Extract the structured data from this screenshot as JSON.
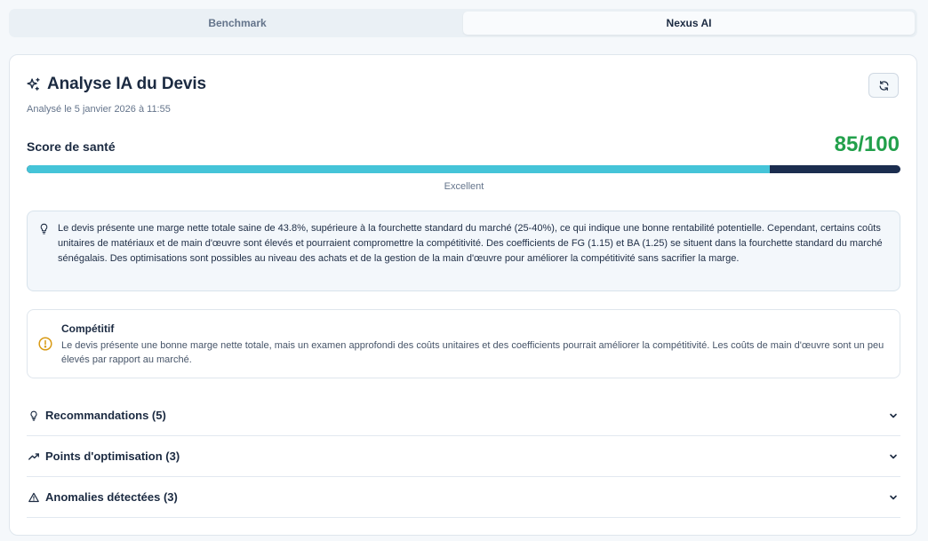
{
  "tabs": [
    {
      "label": "Benchmark",
      "active": false
    },
    {
      "label": "Nexus AI",
      "active": true
    }
  ],
  "analysis": {
    "title": "Analyse IA du Devis",
    "timestamp": "Analysé le 5 janvier 2026 à 11:55",
    "refresh_icon": "refresh-icon",
    "sparkles_icon": "sparkles-icon"
  },
  "score": {
    "label": "Score de santé",
    "display": "85/100",
    "value": 85,
    "max": 100,
    "caption": "Excellent",
    "color": "#22a04b",
    "bar_fill_color": "#45c4d8",
    "bar_track_color": "#1b2d4f"
  },
  "summary": {
    "icon": "lightbulb-icon",
    "text": "Le devis présente une marge nette totale saine de 43.8%, supérieure à la fourchette standard du marché (25-40%), ce qui indique une bonne rentabilité potentielle. Cependant, certains coûts unitaires de matériaux et de main d'œuvre sont élevés et pourraient compromettre la compétitivité. Des coefficients de FG (1.15) et BA (1.25) se situent dans la fourchette standard du marché sénégalais. Des optimisations sont possibles au niveau des achats et de la gestion de la main d'œuvre pour améliorer la compétitivité sans sacrifier la marge."
  },
  "status": {
    "icon": "warning-circle-icon",
    "title": "Compétitif",
    "text": "Le devis présente une bonne marge nette totale, mais un examen approfondi des coûts unitaires et des coefficients pourrait améliorer la compétitivité. Les coûts de main d'œuvre sont un peu élevés par rapport au marché.",
    "accent": "#d99a14"
  },
  "sections": [
    {
      "icon": "lightbulb-icon",
      "label": "Recommandations (5)"
    },
    {
      "icon": "trending-up-icon",
      "label": "Points d'optimisation (3)"
    },
    {
      "icon": "alert-triangle-icon",
      "label": "Anomalies détectées (3)"
    }
  ]
}
